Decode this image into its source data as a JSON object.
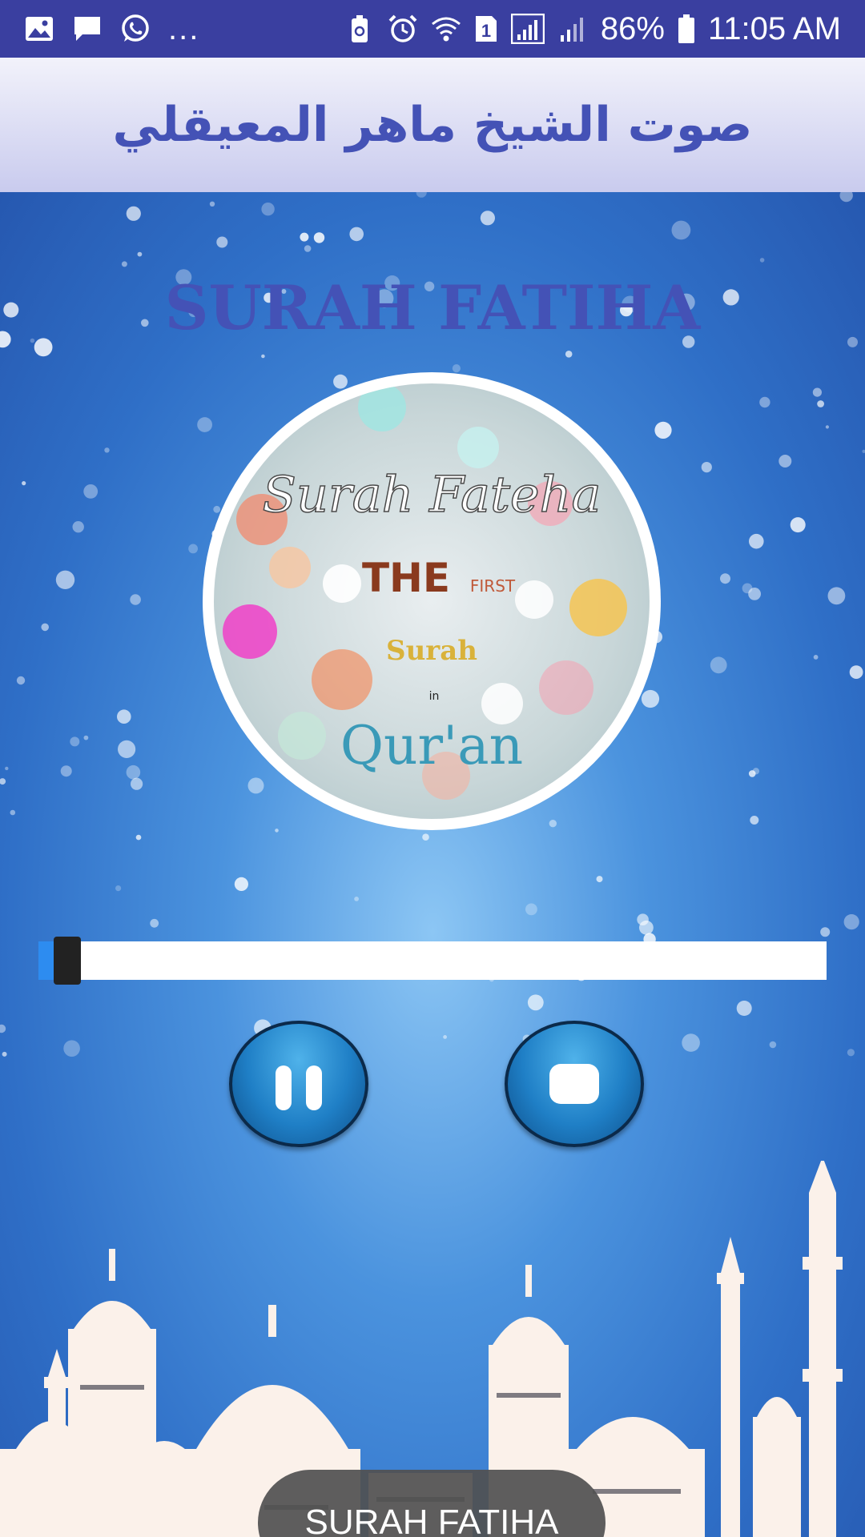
{
  "status_bar": {
    "left_icons": [
      "gallery-icon",
      "message-icon",
      "whatsapp-icon"
    ],
    "overflow": "...",
    "right_icons": [
      "battery-saver-icon",
      "alarm-icon",
      "wifi-icon",
      "sim-1-icon",
      "signal-icon",
      "signal-2-icon"
    ],
    "sim_label": "1",
    "battery": "86%",
    "time": "11:05 AM"
  },
  "app_bar": {
    "title": "صوت الشيخ ماهر المعيقلي"
  },
  "player": {
    "surah_title": "SURAH FATIHA",
    "cover_art": {
      "line1": "Surah Fateha",
      "line2": "THE",
      "line2_small": "FIRST",
      "line3": "Surah",
      "line4": "in",
      "line5": "Qur'an"
    },
    "progress": 0.02,
    "controls": [
      "pause-icon",
      "stop-icon"
    ]
  },
  "toast": {
    "message": "SURAH FATIHA"
  },
  "colors": {
    "status_bar": "#3a3fa0",
    "title_blue": "#4452b6",
    "toast_bg": "#505050"
  }
}
